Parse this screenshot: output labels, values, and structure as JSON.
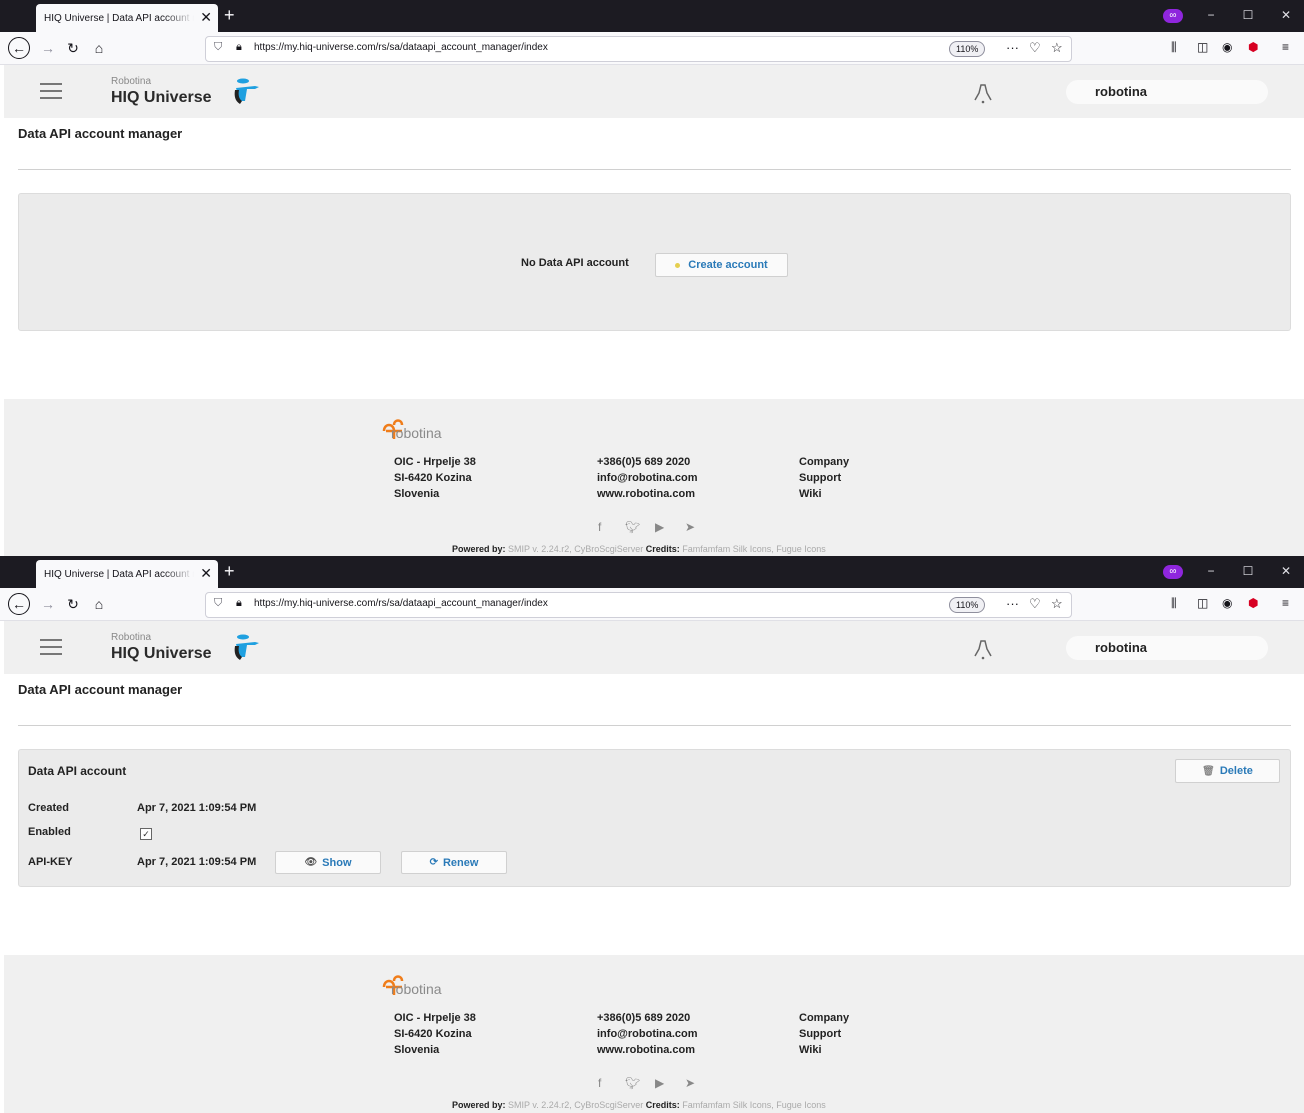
{
  "browser": {
    "tab_title": "HIQ Universe | Data API account manager",
    "tab_close": "✕",
    "new_tab": "+",
    "url": "https://my.hiq-universe.com/rs/sa/dataapi_account_manager/index",
    "zoom": "110%",
    "minimize": "−",
    "maximize": "☐",
    "close": "✕"
  },
  "header": {
    "brand_sub": "Robotina",
    "brand_main": "HIQ Universe",
    "user": "robotina"
  },
  "page": {
    "title": "Data API account manager"
  },
  "state_empty": {
    "message": "No Data API account",
    "create_label": "Create account"
  },
  "state_account": {
    "title": "Data API account",
    "delete_label": "Delete",
    "rows": [
      {
        "label": "Created",
        "value": "Apr 7, 2021 1:09:54 PM"
      },
      {
        "label": "Enabled",
        "value": ""
      },
      {
        "label": "API-KEY",
        "value": "Apr 7, 2021 1:09:54 PM"
      }
    ],
    "enabled": true,
    "show_label": "Show",
    "renew_label": "Renew"
  },
  "footer": {
    "logo_text": "robotina",
    "address": [
      "OIC - Hrpelje 38",
      "SI-6420 Kozina",
      "Slovenia"
    ],
    "contact": [
      "+386(0)5 689 2020",
      "info@robotina.com",
      "www.robotina.com"
    ],
    "links": [
      "Company",
      "Support",
      "Wiki"
    ],
    "powered_label": "Powered by:",
    "powered_value": " SMIP v. 2.24.r2, CyBroScgiServer ",
    "credits_label": "Credits:",
    "credits_value": " Famfamfam Silk Icons, Fugue Icons"
  },
  "colors": {
    "accent": "#2a7ab8",
    "brand_orange": "#f07d1a",
    "private_purple": "#8f26dd"
  }
}
